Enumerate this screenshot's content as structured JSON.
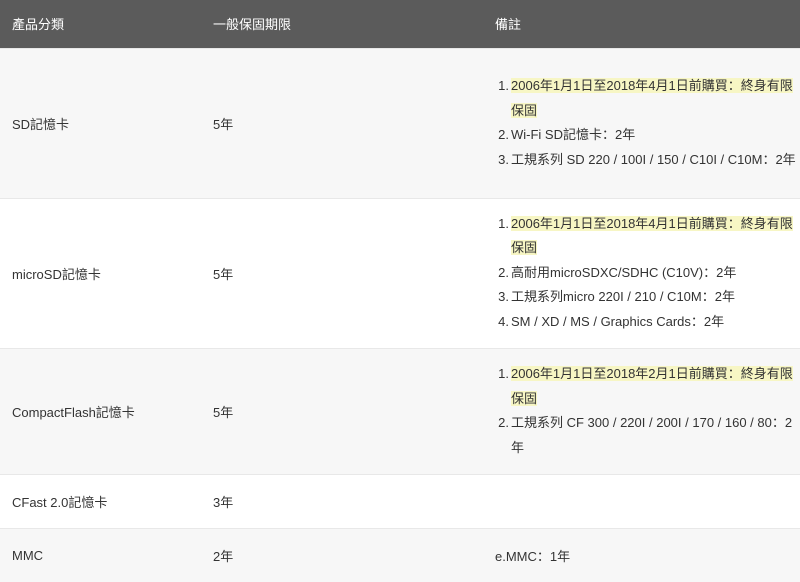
{
  "table": {
    "headers": [
      "產品分類",
      "一般保固期限",
      "備註"
    ],
    "rows": [
      {
        "category": "SD記憶卡",
        "period": "5年",
        "notes": [
          {
            "num": "1.",
            "text": "2006年1月1日至2018年4月1日前購買：終身有限保固",
            "highlight": true
          },
          {
            "num": "2.",
            "text": "Wi-Fi SD記憶卡：2年",
            "highlight": false
          },
          {
            "num": "3.",
            "text": "工規系列 SD 220 / 100I / 150 / C10I / C10M：2年",
            "highlight": false
          }
        ]
      },
      {
        "category": "microSD記憶卡",
        "period": "5年",
        "notes": [
          {
            "num": "1.",
            "text": "2006年1月1日至2018年4月1日前購買：終身有限保固",
            "highlight": true
          },
          {
            "num": "2.",
            "text": "高耐用microSDXC/SDHC (C10V)：2年",
            "highlight": false
          },
          {
            "num": "3.",
            "text": "工規系列micro 220I / 210 / C10M：2年",
            "highlight": false
          },
          {
            "num": "4.",
            "text": "SM / XD / MS / Graphics Cards：2年",
            "highlight": false
          }
        ]
      },
      {
        "category": "CompactFlash記憶卡",
        "period": "5年",
        "notes": [
          {
            "num": "1.",
            "text": "2006年1月1日至2018年2月1日前購買：終身有限保固",
            "highlight": true
          },
          {
            "num": "2.",
            "text": "工規系列 CF 300 / 220I / 200I / 170 / 160 / 80：2年",
            "highlight": false
          }
        ]
      },
      {
        "category": "CFast 2.0記憶卡",
        "period": "3年",
        "notes_text": ""
      },
      {
        "category": "MMC",
        "period": "2年",
        "notes_text": "e.MMC：1年"
      }
    ]
  },
  "colors": {
    "header_bg": "#5b5b5b",
    "highlight": "#f7f6c4",
    "row_alt_bg": "#f7f7f7"
  }
}
